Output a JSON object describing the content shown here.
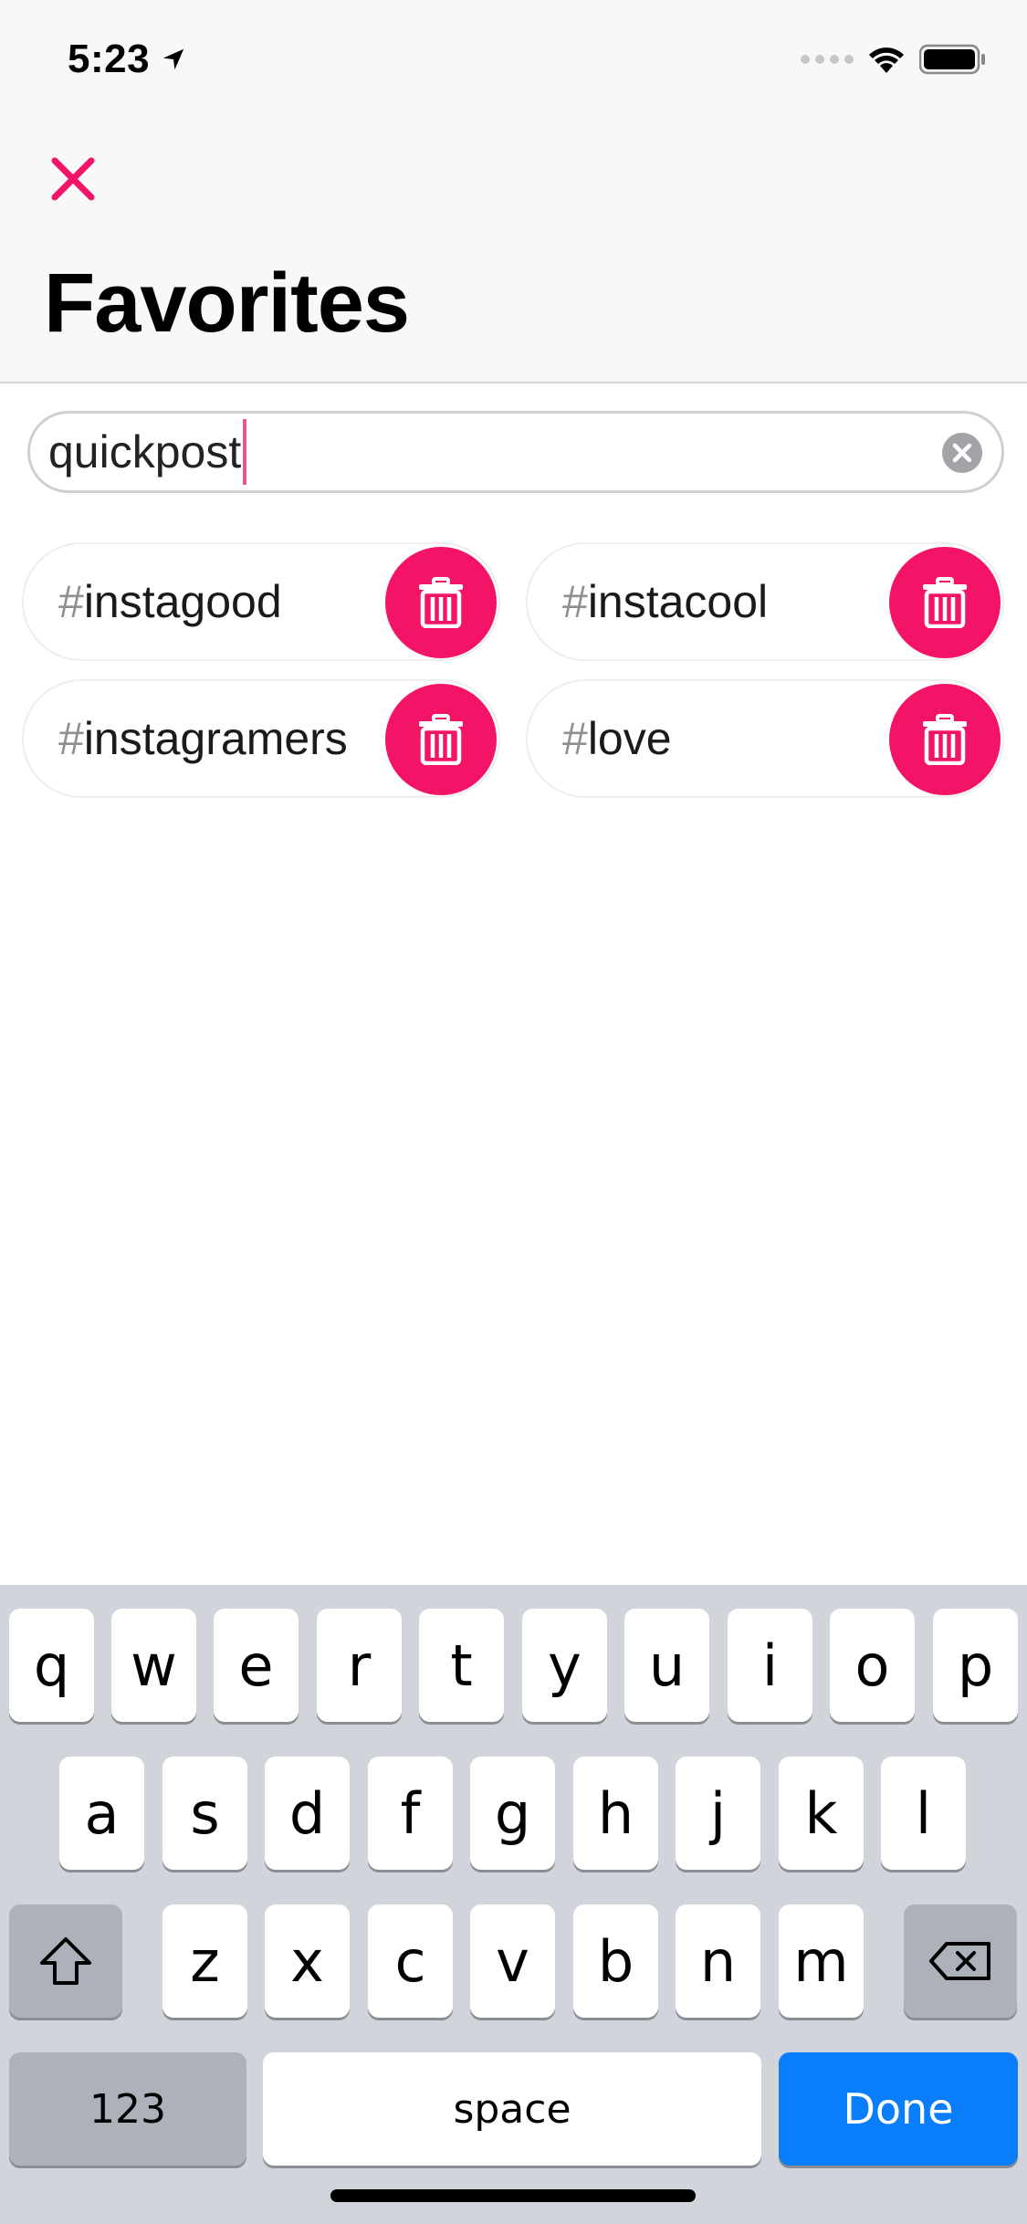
{
  "status_bar": {
    "time": "5:23"
  },
  "header": {
    "title": "Favorites"
  },
  "search": {
    "value": "quickpost"
  },
  "tags": [
    {
      "hash": "#",
      "name": "instagood"
    },
    {
      "hash": "#",
      "name": "instacool"
    },
    {
      "hash": "#",
      "name": "instagramers"
    },
    {
      "hash": "#",
      "name": "love"
    }
  ],
  "keyboard": {
    "row1": [
      "q",
      "w",
      "e",
      "r",
      "t",
      "y",
      "u",
      "i",
      "o",
      "p"
    ],
    "row2": [
      "a",
      "s",
      "d",
      "f",
      "g",
      "h",
      "j",
      "k",
      "l"
    ],
    "row3": [
      "z",
      "x",
      "c",
      "v",
      "b",
      "n",
      "m"
    ],
    "numbers_label": "123",
    "space_label": "space",
    "done_label": "Done"
  },
  "colors": {
    "accent": "#f41467",
    "done_blue": "#0a7dfb"
  }
}
